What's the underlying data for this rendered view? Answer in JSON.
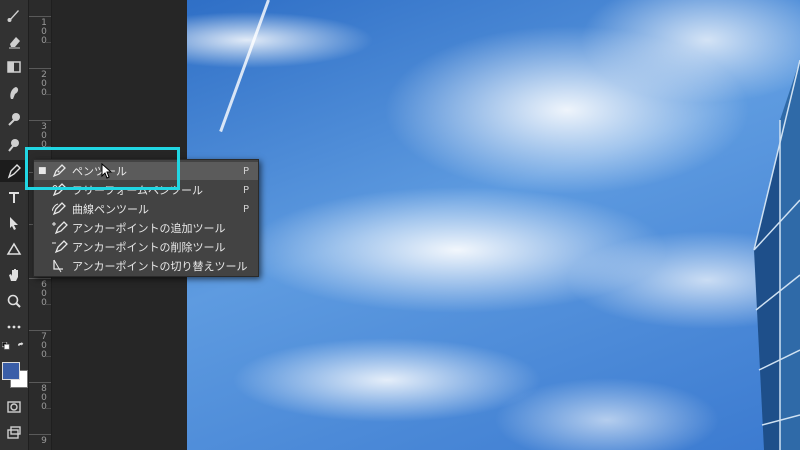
{
  "ruler": {
    "labels": [
      "100",
      "200",
      "300",
      "400",
      "500",
      "600",
      "700",
      "800",
      "9"
    ]
  },
  "pen_tool_menu": {
    "items": [
      {
        "bullet": "■",
        "label": "ペンツール",
        "shortcut": "P",
        "icon": "pen-icon"
      },
      {
        "bullet": "",
        "label": "フリーフォームペンツール",
        "shortcut": "P",
        "icon": "freeform-pen-icon"
      },
      {
        "bullet": "",
        "label": "曲線ペンツール",
        "shortcut": "P",
        "icon": "curvature-pen-icon"
      },
      {
        "bullet": "",
        "label": "アンカーポイントの追加ツール",
        "shortcut": "",
        "icon": "add-anchor-point-icon"
      },
      {
        "bullet": "",
        "label": "アンカーポイントの削除ツール",
        "shortcut": "",
        "icon": "delete-anchor-point-icon"
      },
      {
        "bullet": "",
        "label": "アンカーポイントの切り替えツール",
        "shortcut": "",
        "icon": "convert-point-icon"
      }
    ]
  },
  "colors": {
    "highlight_box": "#21d6e3",
    "foreground": "#3a5ea8",
    "background": "#ffffff"
  }
}
